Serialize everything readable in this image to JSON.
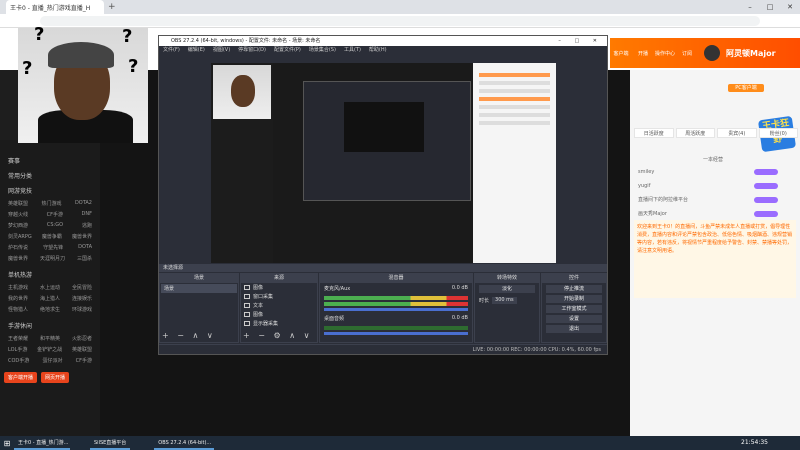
{
  "browser": {
    "tab1": "王卡0 - 直播_热门游戏直播_H",
    "tab2": "",
    "new_tab": "+",
    "address": "",
    "win_min": "–",
    "win_max": "□",
    "win_close": "✕"
  },
  "huya": {
    "user_name": "阿灵顿Major",
    "icons": [
      "客户端",
      "开播",
      "操作中心",
      "订阅"
    ],
    "left_menu_first": "赛事",
    "cat_title": "常用分类",
    "hot_title": "网游竞技",
    "hot_rows": [
      [
        "英雄联盟",
        "热门游戏",
        "DOTA2"
      ],
      [
        "穿越火线",
        "CF手游",
        "DNF"
      ],
      [
        "梦幻西游",
        "CS:GO",
        "逃跑"
      ],
      [
        "剑灵ARPG",
        "魔兽争霸",
        "魔兽世界"
      ],
      [
        "炉石传说",
        "守望先锋",
        "DOTA"
      ],
      [
        "魔兽世界",
        "天涯明月刀",
        "三国杀"
      ]
    ],
    "single_title": "单机热游",
    "single_rows": [
      [
        "主机游戏",
        "水上运动",
        "全民冒险"
      ],
      [
        "我的世界",
        "海上猎人",
        "连接娱乐"
      ],
      [
        "怪物猎人",
        "绝地求生",
        "环球游戏"
      ]
    ],
    "mobile_title": "手游休闲",
    "mobile_rows": [
      [
        "王者荣耀",
        "和平精英",
        "火影忍者"
      ],
      [
        "LOL手游",
        "金铲铲之战",
        "英雄联盟"
      ],
      [
        "COD手游",
        "蛋仔派对",
        "CF手游"
      ]
    ],
    "btn_client": "客户端开播",
    "btn_web": "网页开播"
  },
  "obs": {
    "title": "OBS 27.2.4 (64-bit, windows) - 配置文件: 未命名 - 场景: 未命名",
    "menu": [
      "文件(F)",
      "编辑(E)",
      "视图(V)",
      "停靠窗口(D)",
      "配置文件(P)",
      "场景集合(S)",
      "工具(T)",
      "帮助(H)"
    ],
    "dock_scenes": "场景",
    "scene_item": "场景",
    "dock_sources": "来源",
    "sources": [
      "图像",
      "窗口采集",
      "文本",
      "图像",
      "显示器采集"
    ],
    "dock_mixer": "混音器",
    "mixer_1": "麦克风/Aux",
    "mixer_1_db": "0.0 dB",
    "mixer_2": "桌面音频",
    "mixer_2_db": "0.0 dB",
    "dock_transitions": "转场特效",
    "transition_type": "淡化",
    "duration_label": "时长",
    "duration_value": "300 ms",
    "dock_controls": "控件",
    "controls": [
      "停止推流",
      "开始录制",
      "工作室模式",
      "设置",
      "退出"
    ],
    "status": "LIVE: 00:00:00   REC: 00:00:00   CPU: 0.4%, 60.00 fps",
    "no_source": "未选择源"
  },
  "chat": {
    "pc_button": "PC客户端",
    "tabs": [
      "日活跃度",
      "周活跃度",
      "贵宾(4)",
      "粉丝(0)"
    ],
    "rows": [
      "一本经营",
      "smiley",
      "yugif",
      "直播间下的阿拉维平台",
      "画天秀Major"
    ],
    "notice": "欢迎来到王卡0！的直播间，斗鱼严禁未成年人直播或打赏，倡导理性消费，直播内容和评论严禁包含政治、低俗色情、吸烟酗酒、违规营销等内容，若有违反，将视情节严重程度给予警告、封禁、禁播等处罚，请注意文明用语。",
    "logo": "王卡狂野"
  },
  "taskbar": {
    "start": "⊞",
    "items": [
      "王卡0 - 直播_热门游...",
      "SilSE直播平台",
      "OBS 27.2.4 (64-bit)..."
    ],
    "time": "21:54:35"
  }
}
